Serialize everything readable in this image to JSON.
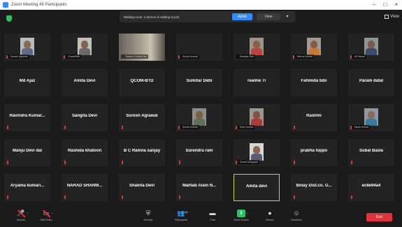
{
  "window": {
    "title": "Zoom Meeting 49 Participants",
    "controls": [
      "–",
      "□",
      "×"
    ]
  },
  "topbar": {
    "view_label": "View"
  },
  "banner": {
    "message": "Waiting room: 1 person is waiting to join",
    "admit_label": "Admit",
    "view_label": "View",
    "more_label": "▾"
  },
  "tiles": [
    {
      "name": "",
      "label": "Suresh Agrawal",
      "kind": "photo",
      "muted": true,
      "face": "#8a6a55",
      "body": "#5a6b8c",
      "bg": "#b8bcbc"
    },
    {
      "name": "",
      "label": "Govardhan",
      "kind": "photo",
      "muted": true,
      "face": "#7e6450",
      "body": "#6a6a6a",
      "bg": "#c2c2b8"
    },
    {
      "name": "",
      "label": "Teacher Sunita Devi",
      "kind": "room",
      "muted": false
    },
    {
      "name": "",
      "label": "Sunita Kumari",
      "kind": "dark",
      "muted": true
    },
    {
      "name": "",
      "label": "Manjula Devi",
      "kind": "photo",
      "muted": false,
      "face": "#8c5d47",
      "body": "#c04040",
      "bg": "#9a948a"
    },
    {
      "name": "",
      "label": "Meera Kumari",
      "kind": "photo",
      "muted": true,
      "face": "#8a5a44",
      "body": "#c87a35",
      "bg": "#a09b95"
    },
    {
      "name": "",
      "label": "Ali Hasan",
      "kind": "photo",
      "muted": true,
      "face": "#7a5a48",
      "body": "#3d4b6b",
      "bg": "#8f9690"
    },
    {
      "name": "Md Ajaz",
      "label": "",
      "kind": "name",
      "muted": false
    },
    {
      "name": "Amita Devi",
      "label": "",
      "kind": "name",
      "muted": false
    },
    {
      "name": "QCOM-BTD",
      "label": "",
      "kind": "name",
      "muted": false
    },
    {
      "name": "Sumitar Debi",
      "label": "",
      "kind": "name",
      "muted": false
    },
    {
      "name": "realme 7i",
      "label": "",
      "kind": "name",
      "muted": false
    },
    {
      "name": "Fahmida bibi",
      "label": "",
      "kind": "name",
      "muted": false
    },
    {
      "name": "Param datal",
      "label": "",
      "kind": "name",
      "muted": false
    },
    {
      "name": "Ravindra Kumar...",
      "label": "",
      "kind": "name",
      "muted": true
    },
    {
      "name": "Sangita Devi",
      "label": "",
      "kind": "name",
      "muted": true
    },
    {
      "name": "Suresh Agrawal",
      "label": "",
      "kind": "name",
      "muted": true
    },
    {
      "name": "",
      "label": "Sunita Kumari",
      "kind": "photo",
      "muted": true,
      "face": "#7d5d46",
      "body": "#5f6f5a",
      "bg": "#8b8f86"
    },
    {
      "name": "",
      "label": "Sunil Kumar",
      "kind": "photo",
      "muted": true,
      "face": "#7a553f",
      "body": "#b03a3a",
      "bg": "#9d978c"
    },
    {
      "name": "Rashmi",
      "label": "",
      "kind": "name",
      "muted": true
    },
    {
      "name": "",
      "label": "Dipak Kumar",
      "kind": "photo",
      "muted": true,
      "face": "#8a6a55",
      "body": "#3a7aa0",
      "bg": "#8a9aa5"
    },
    {
      "name": "Manju Devi dal",
      "label": "",
      "kind": "name",
      "muted": true
    },
    {
      "name": "Rashida khatoon",
      "label": "",
      "kind": "name",
      "muted": true
    },
    {
      "name": "B C Ramna sanjay",
      "label": "",
      "kind": "name",
      "muted": true
    },
    {
      "name": "Surendra ram",
      "label": "",
      "kind": "name",
      "muted": true
    },
    {
      "name": "",
      "label": "Sonali Dasgupta",
      "kind": "photo",
      "muted": true,
      "face": "#8d6650",
      "body": "#5a5a7a",
      "bg": "#d9d6d0"
    },
    {
      "name": "prabha toppo",
      "label": "",
      "kind": "name",
      "muted": true
    },
    {
      "name": "Subal Basla",
      "label": "",
      "kind": "name",
      "muted": true
    },
    {
      "name": "Aryama kumari...",
      "label": "",
      "kind": "name",
      "muted": true
    },
    {
      "name": "NARAD SHARM...",
      "label": "",
      "kind": "name",
      "muted": true
    },
    {
      "name": "Shabita Devi",
      "label": "",
      "kind": "name",
      "muted": true
    },
    {
      "name": "Mahtab Alam N...",
      "label": "",
      "kind": "name",
      "muted": true
    },
    {
      "name": "Amita devi",
      "label": "",
      "kind": "name",
      "muted": false,
      "highlight": true
    },
    {
      "name": "Binay Dist.co. G...",
      "label": "",
      "kind": "name",
      "muted": true
    },
    {
      "name": "ec8e94a4",
      "label": "",
      "kind": "name",
      "muted": true
    }
  ],
  "toolbar": [
    {
      "label": "Unmute",
      "icon": "🎤",
      "name": "unmute-button",
      "slashed": true,
      "caret": true
    },
    {
      "label": "Start Video",
      "icon": "▭",
      "name": "start-video-button",
      "slashed": true,
      "caret": true
    },
    {
      "label": "Security",
      "icon": "⛨",
      "name": "security-button",
      "slashed": false,
      "caret": false
    },
    {
      "label": "Participants",
      "icon": "👥",
      "name": "participants-button",
      "slashed": false,
      "caret": true,
      "count": "49"
    },
    {
      "label": "Chat",
      "icon": "▬",
      "name": "chat-button",
      "slashed": false,
      "caret": false
    },
    {
      "label": "Share Screen",
      "icon": "⬆",
      "name": "share-screen-button",
      "slashed": false,
      "caret": true,
      "green": true
    },
    {
      "label": "Record",
      "icon": "●",
      "name": "record-button",
      "slashed": false,
      "caret": false
    },
    {
      "label": "Reactions",
      "icon": "☺",
      "name": "reactions-button",
      "slashed": false,
      "caret": false
    }
  ],
  "end_label": "End",
  "colors": {
    "accent": "#2d8cff",
    "mute": "#e0333a",
    "active_speaker": "#c9d23a",
    "share": "#23c55e",
    "end": "#e0333a"
  }
}
